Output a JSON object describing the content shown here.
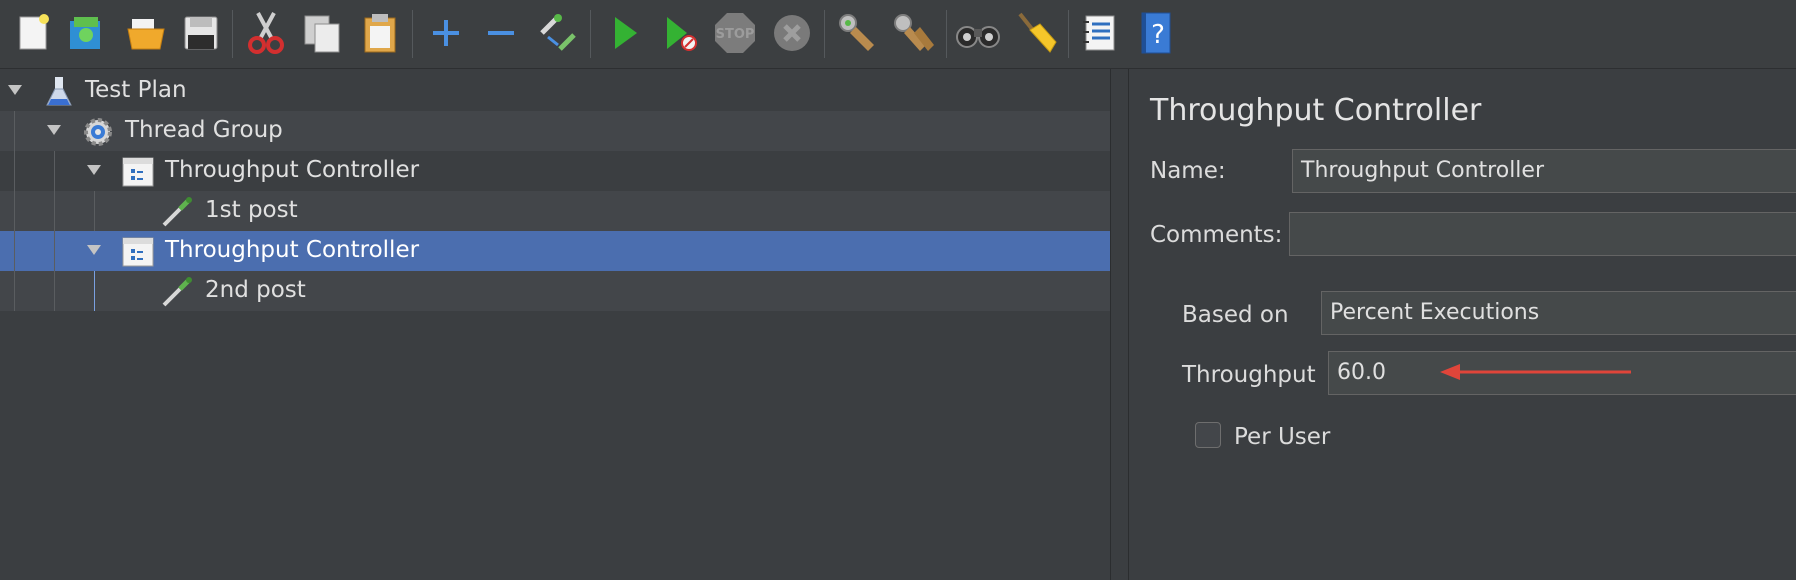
{
  "toolbar": {
    "buttons": [
      {
        "name": "new-icon"
      },
      {
        "name": "templates-icon"
      },
      {
        "name": "open-icon"
      },
      {
        "name": "save-icon"
      },
      {
        "name": "cut-icon"
      },
      {
        "name": "copy-icon"
      },
      {
        "name": "paste-icon"
      },
      {
        "name": "expand-icon"
      },
      {
        "name": "collapse-icon"
      },
      {
        "name": "toggle-icon"
      },
      {
        "name": "start-icon"
      },
      {
        "name": "start-no-timers-icon"
      },
      {
        "name": "stop-icon"
      },
      {
        "name": "shutdown-icon"
      },
      {
        "name": "clear-icon"
      },
      {
        "name": "clear-all-icon"
      },
      {
        "name": "search-icon"
      },
      {
        "name": "reset-search-icon"
      },
      {
        "name": "function-helper-icon"
      },
      {
        "name": "help-icon"
      }
    ],
    "stop_text": "STOP"
  },
  "tree": {
    "nodes": [
      {
        "label": "Test Plan",
        "icon": "flask-icon"
      },
      {
        "label": "Thread Group",
        "icon": "gear-icon"
      },
      {
        "label": "Throughput Controller",
        "icon": "controller-icon"
      },
      {
        "label": "1st post",
        "icon": "pipette-icon"
      },
      {
        "label": "Throughput Controller",
        "icon": "controller-icon"
      },
      {
        "label": "2nd post",
        "icon": "pipette-icon"
      }
    ],
    "selected_index": 4
  },
  "panel": {
    "title": "Throughput Controller",
    "name_label": "Name:",
    "name_value": "Throughput Controller",
    "comments_label": "Comments:",
    "comments_value": "",
    "based_on_label": "Based on",
    "based_on_value": "Percent Executions",
    "throughput_label": "Throughput",
    "throughput_value": "60.0",
    "per_user_label": "Per User",
    "per_user_checked": false
  },
  "colors": {
    "selection": "#4b6eaf",
    "arrow": "#e0453a"
  }
}
